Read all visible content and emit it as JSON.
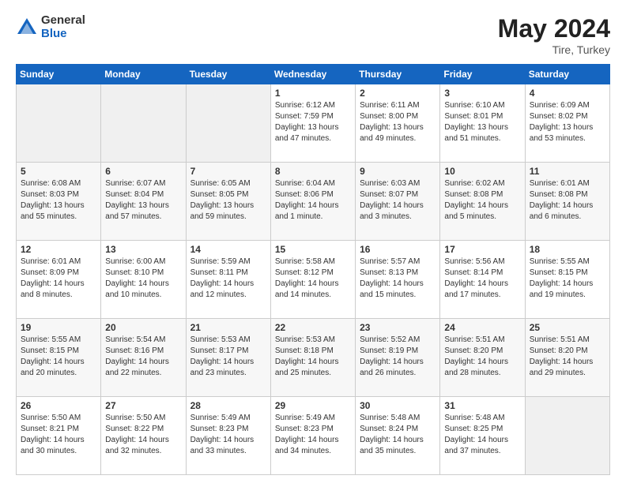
{
  "header": {
    "logo": {
      "line1": "General",
      "line2": "Blue"
    },
    "title": "May 2024",
    "location": "Tire, Turkey"
  },
  "weekdays": [
    "Sunday",
    "Monday",
    "Tuesday",
    "Wednesday",
    "Thursday",
    "Friday",
    "Saturday"
  ],
  "weeks": [
    [
      {
        "day": "",
        "info": ""
      },
      {
        "day": "",
        "info": ""
      },
      {
        "day": "",
        "info": ""
      },
      {
        "day": "1",
        "info": "Sunrise: 6:12 AM\nSunset: 7:59 PM\nDaylight: 13 hours\nand 47 minutes."
      },
      {
        "day": "2",
        "info": "Sunrise: 6:11 AM\nSunset: 8:00 PM\nDaylight: 13 hours\nand 49 minutes."
      },
      {
        "day": "3",
        "info": "Sunrise: 6:10 AM\nSunset: 8:01 PM\nDaylight: 13 hours\nand 51 minutes."
      },
      {
        "day": "4",
        "info": "Sunrise: 6:09 AM\nSunset: 8:02 PM\nDaylight: 13 hours\nand 53 minutes."
      }
    ],
    [
      {
        "day": "5",
        "info": "Sunrise: 6:08 AM\nSunset: 8:03 PM\nDaylight: 13 hours\nand 55 minutes."
      },
      {
        "day": "6",
        "info": "Sunrise: 6:07 AM\nSunset: 8:04 PM\nDaylight: 13 hours\nand 57 minutes."
      },
      {
        "day": "7",
        "info": "Sunrise: 6:05 AM\nSunset: 8:05 PM\nDaylight: 13 hours\nand 59 minutes."
      },
      {
        "day": "8",
        "info": "Sunrise: 6:04 AM\nSunset: 8:06 PM\nDaylight: 14 hours\nand 1 minute."
      },
      {
        "day": "9",
        "info": "Sunrise: 6:03 AM\nSunset: 8:07 PM\nDaylight: 14 hours\nand 3 minutes."
      },
      {
        "day": "10",
        "info": "Sunrise: 6:02 AM\nSunset: 8:08 PM\nDaylight: 14 hours\nand 5 minutes."
      },
      {
        "day": "11",
        "info": "Sunrise: 6:01 AM\nSunset: 8:08 PM\nDaylight: 14 hours\nand 6 minutes."
      }
    ],
    [
      {
        "day": "12",
        "info": "Sunrise: 6:01 AM\nSunset: 8:09 PM\nDaylight: 14 hours\nand 8 minutes."
      },
      {
        "day": "13",
        "info": "Sunrise: 6:00 AM\nSunset: 8:10 PM\nDaylight: 14 hours\nand 10 minutes."
      },
      {
        "day": "14",
        "info": "Sunrise: 5:59 AM\nSunset: 8:11 PM\nDaylight: 14 hours\nand 12 minutes."
      },
      {
        "day": "15",
        "info": "Sunrise: 5:58 AM\nSunset: 8:12 PM\nDaylight: 14 hours\nand 14 minutes."
      },
      {
        "day": "16",
        "info": "Sunrise: 5:57 AM\nSunset: 8:13 PM\nDaylight: 14 hours\nand 15 minutes."
      },
      {
        "day": "17",
        "info": "Sunrise: 5:56 AM\nSunset: 8:14 PM\nDaylight: 14 hours\nand 17 minutes."
      },
      {
        "day": "18",
        "info": "Sunrise: 5:55 AM\nSunset: 8:15 PM\nDaylight: 14 hours\nand 19 minutes."
      }
    ],
    [
      {
        "day": "19",
        "info": "Sunrise: 5:55 AM\nSunset: 8:15 PM\nDaylight: 14 hours\nand 20 minutes."
      },
      {
        "day": "20",
        "info": "Sunrise: 5:54 AM\nSunset: 8:16 PM\nDaylight: 14 hours\nand 22 minutes."
      },
      {
        "day": "21",
        "info": "Sunrise: 5:53 AM\nSunset: 8:17 PM\nDaylight: 14 hours\nand 23 minutes."
      },
      {
        "day": "22",
        "info": "Sunrise: 5:53 AM\nSunset: 8:18 PM\nDaylight: 14 hours\nand 25 minutes."
      },
      {
        "day": "23",
        "info": "Sunrise: 5:52 AM\nSunset: 8:19 PM\nDaylight: 14 hours\nand 26 minutes."
      },
      {
        "day": "24",
        "info": "Sunrise: 5:51 AM\nSunset: 8:20 PM\nDaylight: 14 hours\nand 28 minutes."
      },
      {
        "day": "25",
        "info": "Sunrise: 5:51 AM\nSunset: 8:20 PM\nDaylight: 14 hours\nand 29 minutes."
      }
    ],
    [
      {
        "day": "26",
        "info": "Sunrise: 5:50 AM\nSunset: 8:21 PM\nDaylight: 14 hours\nand 30 minutes."
      },
      {
        "day": "27",
        "info": "Sunrise: 5:50 AM\nSunset: 8:22 PM\nDaylight: 14 hours\nand 32 minutes."
      },
      {
        "day": "28",
        "info": "Sunrise: 5:49 AM\nSunset: 8:23 PM\nDaylight: 14 hours\nand 33 minutes."
      },
      {
        "day": "29",
        "info": "Sunrise: 5:49 AM\nSunset: 8:23 PM\nDaylight: 14 hours\nand 34 minutes."
      },
      {
        "day": "30",
        "info": "Sunrise: 5:48 AM\nSunset: 8:24 PM\nDaylight: 14 hours\nand 35 minutes."
      },
      {
        "day": "31",
        "info": "Sunrise: 5:48 AM\nSunset: 8:25 PM\nDaylight: 14 hours\nand 37 minutes."
      },
      {
        "day": "",
        "info": ""
      }
    ]
  ]
}
